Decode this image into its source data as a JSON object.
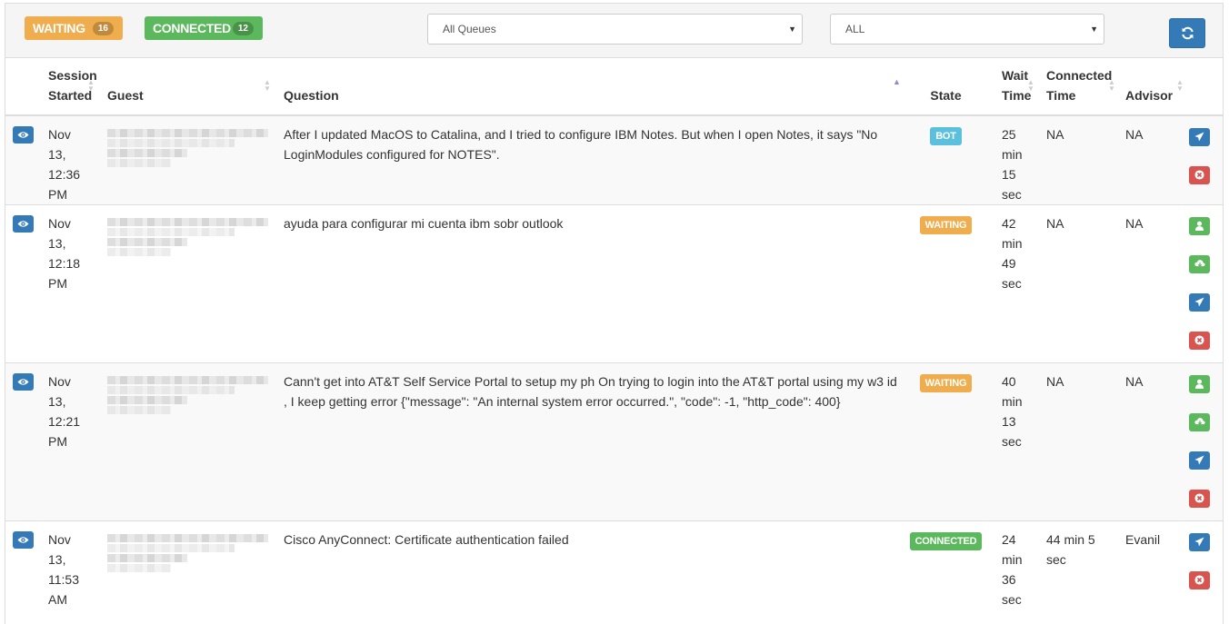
{
  "toolbar": {
    "waiting_label": "WAITING",
    "waiting_count": "16",
    "connected_label": "CONNECTED",
    "connected_count": "12",
    "queue_select": "All Queues",
    "filter_select": "ALL",
    "refresh_icon": "refresh-icon"
  },
  "columns": {
    "session_started_1": "Session",
    "session_started_2": "Started",
    "guest": "Guest",
    "question": "Question",
    "state": "State",
    "wait_time_1": "Wait",
    "wait_time_2": "Time",
    "connected_time_1": "Connected",
    "connected_time_2": "Time",
    "advisor": "Advisor"
  },
  "rows": [
    {
      "started": [
        "Nov",
        "13,",
        "12:36",
        "PM"
      ],
      "question": "After I updated MacOS to Catalina, and I tried to configure IBM Notes. But when I open Notes, it says \"No LoginModules configured for NOTES\".",
      "state": "BOT",
      "wait": [
        "25",
        "min",
        "15",
        "sec"
      ],
      "connected_time": "NA",
      "advisor": "NA",
      "actions": [
        "send-icon",
        "cancel-icon"
      ]
    },
    {
      "started": [
        "Nov",
        "13,",
        "12:18",
        "PM"
      ],
      "question": "ayuda para configurar mi cuenta ibm sobr outlook",
      "state": "WAITING",
      "wait": [
        "42",
        "min",
        "49",
        "sec"
      ],
      "connected_time": "NA",
      "advisor": "NA",
      "actions": [
        "user-icon",
        "cloud-download-icon",
        "send-icon",
        "cancel-icon"
      ]
    },
    {
      "started": [
        "Nov",
        "13,",
        "12:21",
        "PM"
      ],
      "question": "Cann't get into AT&T Self Service Portal to setup my ph On trying to login into the AT&T portal using my w3 id , I keep getting error {\"message\": \"An internal system error occurred.\", \"code\": -1, \"http_code\": 400}",
      "state": "WAITING",
      "wait": [
        "40",
        "min",
        "13",
        "sec"
      ],
      "connected_time": "NA",
      "advisor": "NA",
      "actions": [
        "user-icon",
        "cloud-download-icon",
        "send-icon",
        "cancel-icon"
      ]
    },
    {
      "started": [
        "Nov",
        "13,",
        "11:53",
        "AM"
      ],
      "question": "Cisco AnyConnect: Certificate authentication failed",
      "state": "CONNECTED",
      "wait": [
        "24",
        "min",
        "36",
        "sec"
      ],
      "connected_time": "44 min 5 sec",
      "advisor": "Evanil",
      "actions": [
        "send-icon",
        "cancel-icon"
      ]
    }
  ],
  "colors": {
    "waiting": "#f0ad4e",
    "connected": "#5cb85c",
    "bot": "#5bc0de",
    "primary": "#337ab7",
    "danger": "#d9534f"
  }
}
